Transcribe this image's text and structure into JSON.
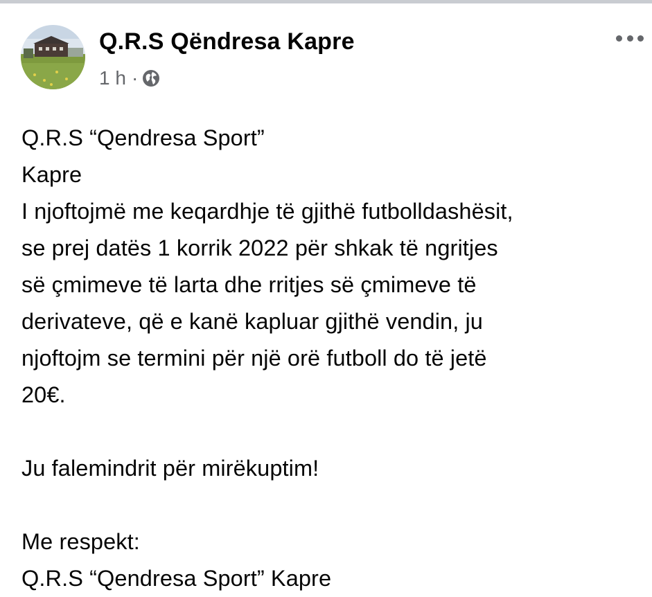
{
  "post": {
    "author": "Q.R.S Qëndresa Kapre",
    "time": "1 h",
    "separator": "·",
    "privacy_icon": "globe-icon",
    "more_icon": "more-horizontal-icon",
    "lines": [
      "Q.R.S “Qendresa Sport”",
      "Kapre",
      "I njoftojmë me keqardhje të gjithë futbolldashësit,",
      "se prej datës 1 korrik 2022 për shkak të ngritjes",
      "së çmimeve të larta dhe rritjes së çmimeve të",
      "derivateve, që e kanë kapluar gjithë vendin, ju",
      "njoftojm se termini për një orë futboll do të jetë",
      "20€.",
      "",
      "Ju falemindrit për mirëkuptim!",
      "",
      "Me respekt:",
      "Q.R.S “Qendresa Sport” Kapre"
    ]
  },
  "colors": {
    "text": "#050505",
    "secondary": "#65676b",
    "divider": "#c9ccd1",
    "background": "#ffffff"
  }
}
